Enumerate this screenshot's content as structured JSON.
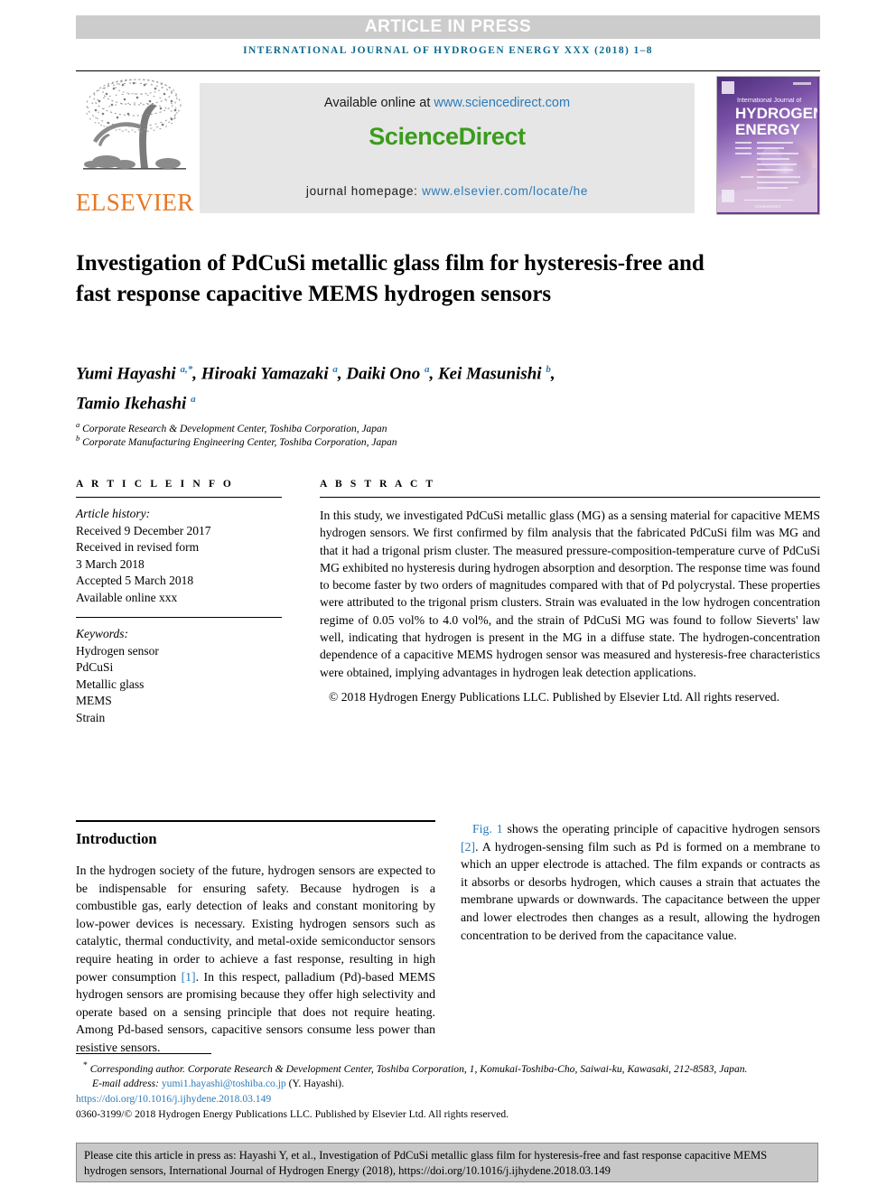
{
  "banner": {
    "text": "ARTICLE IN PRESS"
  },
  "running_head": {
    "text": "INTERNATIONAL JOURNAL OF HYDROGEN ENERGY XXX (2018) 1–8"
  },
  "masthead": {
    "publisher_logo_label": "ELSEVIER",
    "available_prefix": "Available online at ",
    "available_url": "www.sciencedirect.com",
    "sciencedirect_logo": "ScienceDirect",
    "homepage_prefix": "journal homepage: ",
    "homepage_url": "www.elsevier.com/locate/he",
    "cover_lines": {
      "line1": "International Journal of",
      "line2": "HYDROGEN",
      "line3": "ENERGY"
    }
  },
  "article": {
    "title": "Investigation of PdCuSi metallic glass film for hysteresis-free and fast response capacitive MEMS hydrogen sensors",
    "authors_line1_part1": "Yumi Hayashi ",
    "authors_sup1": "a,*",
    "authors_line1_part2": ", Hiroaki Yamazaki ",
    "authors_sup2": "a",
    "authors_line1_part3": ", Daiki Ono ",
    "authors_sup3": "a",
    "authors_line1_part4": ", Kei Masunishi ",
    "authors_sup4": "b",
    "authors_line1_part5": ",",
    "authors_line2_part1": "Tamio Ikehashi ",
    "authors_sup5": "a",
    "affiliation_a_sup": "a",
    "affiliation_a": " Corporate Research & Development Center, Toshiba Corporation, Japan",
    "affiliation_b_sup": "b",
    "affiliation_b": " Corporate Manufacturing Engineering Center, Toshiba Corporation, Japan"
  },
  "article_info": {
    "label": "A R T I C L E   I N F O",
    "history_label": "Article history:",
    "history": [
      "Received 9 December 2017",
      "Received in revised form",
      "3 March 2018",
      "Accepted 5 March 2018",
      "Available online xxx"
    ],
    "keywords_label": "Keywords:",
    "keywords": [
      "Hydrogen sensor",
      "PdCuSi",
      "Metallic glass",
      "MEMS",
      "Strain"
    ]
  },
  "abstract": {
    "label": "A B S T R A C T",
    "text": "In this study, we investigated PdCuSi metallic glass (MG) as a sensing material for capacitive MEMS hydrogen sensors. We first confirmed by film analysis that the fabricated PdCuSi film was MG and that it had a trigonal prism cluster. The measured pressure-composition-temperature curve of PdCuSi MG exhibited no hysteresis during hydrogen absorption and desorption. The response time was found to become faster by two orders of magnitudes compared with that of Pd polycrystal. These properties were attributed to the trigonal prism clusters. Strain was evaluated in the low hydrogen concentration regime of 0.05 vol% to 4.0 vol%, and the strain of PdCuSi MG was found to follow Sieverts' law well, indicating that hydrogen is present in the MG in a diffuse state. The hydrogen-concentration dependence of a capacitive MEMS hydrogen sensor was measured and hysteresis-free characteristics were obtained, implying advantages in hydrogen leak detection applications.",
    "copyright": "© 2018 Hydrogen Energy Publications LLC. Published by Elsevier Ltd. All rights reserved."
  },
  "introduction": {
    "heading": "Introduction",
    "para1_a": "In the hydrogen society of the future, hydrogen sensors are expected to be indispensable for ensuring safety. Because hydrogen is a combustible gas, early detection of leaks and constant monitoring by low-power devices is necessary. Existing hydrogen sensors such as catalytic, thermal conductivity, and metal-oxide semiconductor sensors require heating in order to achieve a fast response, resulting in high power consumption ",
    "ref1": "[1]",
    "para1_b": ". In this respect, palladium (Pd)-based MEMS hydrogen sensors are promising because they offer high selectivity and operate based on a sensing principle that does not require heating. Among Pd-based sensors, capacitive sensors consume less power than resistive sensors.",
    "para2_figref": "Fig. 1",
    "para2_a": " shows the operating principle of capacitive hydrogen sensors ",
    "ref2": "[2]",
    "para2_b": ". A hydrogen-sensing film such as Pd is formed on a membrane to which an upper electrode is attached. The film expands or contracts as it absorbs or desorbs hydrogen, which causes a strain that actuates the membrane upwards or downwards. The capacitance between the upper and lower electrodes then changes as a result, allowing the hydrogen concentration to be derived from the capacitance value."
  },
  "footnotes": {
    "corresponding_sup": "*",
    "corresponding": " Corresponding author. Corporate Research & Development Center, Toshiba Corporation, 1, Komukai-Toshiba-Cho, Saiwai-ku, Kawasaki, 212-8583, Japan.",
    "email_label": "E-mail address: ",
    "email": "yumi1.hayashi@toshiba.co.jp",
    "email_suffix": " (Y. Hayashi).",
    "doi": "https://doi.org/10.1016/j.ijhydene.2018.03.149",
    "issn_line": "0360-3199/© 2018 Hydrogen Energy Publications LLC. Published by Elsevier Ltd. All rights reserved."
  },
  "cite_box": {
    "text": "Please cite this article in press as: Hayashi Y, et al., Investigation of PdCuSi metallic glass film for hysteresis-free and fast response capacitive MEMS hydrogen sensors, International Journal of Hydrogen Energy (2018), https://doi.org/10.1016/j.ijhydene.2018.03.149"
  },
  "colors": {
    "banner_bg": "#cccccc",
    "journal_blue": "#0b6a8f",
    "link_blue": "#2b7bba",
    "sciencedirect_green": "#3a9c1c",
    "elsevier_orange": "#e87722",
    "cite_box_bg": "#c8c8c8"
  }
}
